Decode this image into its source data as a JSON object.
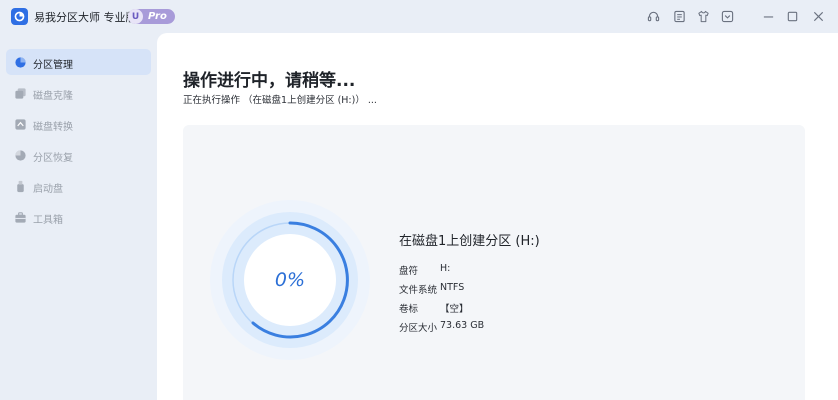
{
  "app": {
    "title": "易我分区大师 专业版",
    "badge_letter": "U",
    "badge_text": "Pro"
  },
  "window_controls": [
    "headset-icon",
    "feedback-icon",
    "shirt-icon",
    "menu-icon",
    "minimize-icon",
    "maximize-icon",
    "close-icon"
  ],
  "sidebar": {
    "items": [
      {
        "label": "分区管理",
        "icon": "pie-chart-icon",
        "active": true
      },
      {
        "label": "磁盘克隆",
        "icon": "disk-clone-icon",
        "active": false
      },
      {
        "label": "磁盘转换",
        "icon": "disk-convert-icon",
        "active": false
      },
      {
        "label": "分区恢复",
        "icon": "recovery-icon",
        "active": false
      },
      {
        "label": "启动盘",
        "icon": "boot-drive-icon",
        "active": false
      },
      {
        "label": "工具箱",
        "icon": "toolbox-icon",
        "active": false
      }
    ]
  },
  "main": {
    "heading": "操作进行中，请稍等...",
    "subheading": "正在执行操作 （在磁盘1上创建分区 (H:)） ..."
  },
  "task": {
    "progress_label": "0%",
    "progress_value": 0,
    "title": "在磁盘1上创建分区 (H:)",
    "details": [
      {
        "key": "盘符",
        "value": "H:"
      },
      {
        "key": "文件系统",
        "value": "NTFS"
      },
      {
        "key": "卷标",
        "value": "【空】"
      },
      {
        "key": "分区大小",
        "value": "73.63 GB"
      }
    ]
  },
  "colors": {
    "accent": "#2f6fe4",
    "ring_light": "#cfe2fb",
    "ring_arc": "#3a7fe0",
    "sidebar_active": "#d6e3f8"
  }
}
